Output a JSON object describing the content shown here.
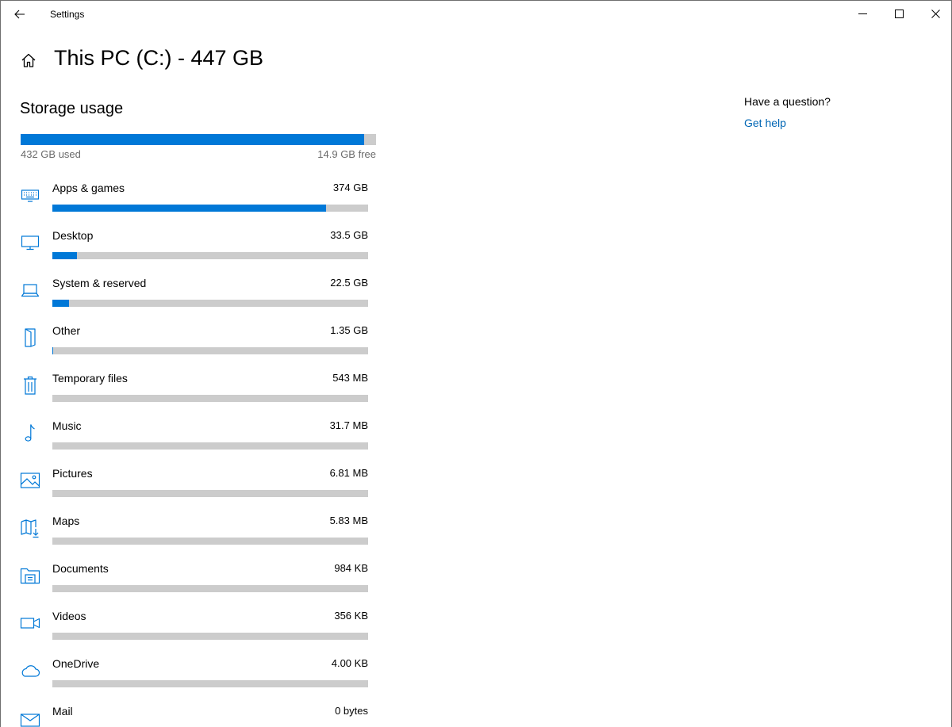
{
  "window": {
    "app_title": "Settings"
  },
  "header": {
    "title": "This PC (C:) - 447 GB"
  },
  "storage": {
    "section_title": "Storage usage",
    "used_label": "432 GB used",
    "free_label": "14.9 GB free",
    "used_fraction": 0.967
  },
  "categories": [
    {
      "name": "Apps & games",
      "size": "374 GB",
      "icon": "keyboard-icon",
      "fraction": 0.868
    },
    {
      "name": "Desktop",
      "size": "33.5 GB",
      "icon": "monitor-icon",
      "fraction": 0.078
    },
    {
      "name": "System & reserved",
      "size": "22.5 GB",
      "icon": "laptop-icon",
      "fraction": 0.052
    },
    {
      "name": "Other",
      "size": "1.35 GB",
      "icon": "other-file-icon",
      "fraction": 0.003
    },
    {
      "name": "Temporary files",
      "size": "543 MB",
      "icon": "trash-icon",
      "fraction": 0
    },
    {
      "name": "Music",
      "size": "31.7 MB",
      "icon": "music-note-icon",
      "fraction": 0
    },
    {
      "name": "Pictures",
      "size": "6.81 MB",
      "icon": "picture-icon",
      "fraction": 0
    },
    {
      "name": "Maps",
      "size": "5.83 MB",
      "icon": "map-download-icon",
      "fraction": 0
    },
    {
      "name": "Documents",
      "size": "984 KB",
      "icon": "documents-folder-icon",
      "fraction": 0
    },
    {
      "name": "Videos",
      "size": "356 KB",
      "icon": "video-camera-icon",
      "fraction": 0
    },
    {
      "name": "OneDrive",
      "size": "4.00 KB",
      "icon": "cloud-icon",
      "fraction": 0
    },
    {
      "name": "Mail",
      "size": "0 bytes",
      "icon": "mail-icon",
      "fraction": 0
    }
  ],
  "help": {
    "question": "Have a question?",
    "link": "Get help"
  },
  "colors": {
    "accent": "#0078d7",
    "bar_track": "#cccccc",
    "link": "#0066b4"
  }
}
